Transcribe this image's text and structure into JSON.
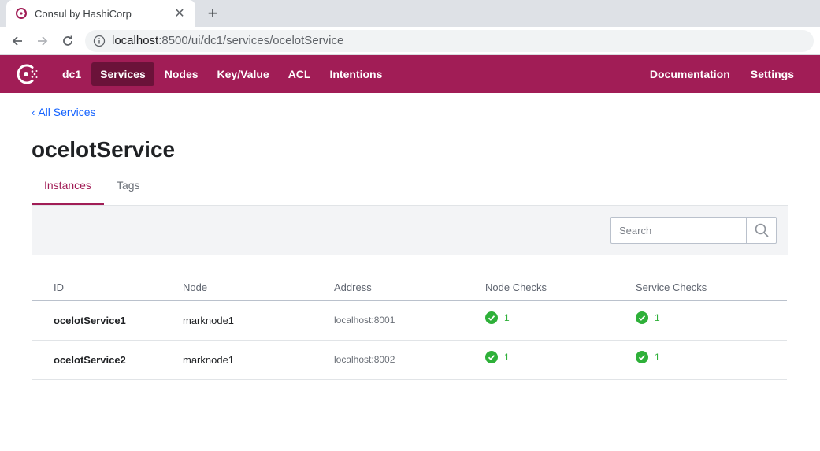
{
  "browser": {
    "tab_title": "Consul by HashiCorp",
    "url_host": "localhost",
    "url_rest": ":8500/ui/dc1/services/ocelotService"
  },
  "nav": {
    "dc": "dc1",
    "items": [
      "Services",
      "Nodes",
      "Key/Value",
      "ACL",
      "Intentions"
    ],
    "active": "Services",
    "right": [
      "Documentation",
      "Settings"
    ]
  },
  "breadcrumb": "All Services",
  "title": "ocelotService",
  "tabs": [
    "Instances",
    "Tags"
  ],
  "search": {
    "placeholder": "Search"
  },
  "table": {
    "headers": [
      "ID",
      "Node",
      "Address",
      "Node Checks",
      "Service Checks"
    ],
    "rows": [
      {
        "id": "ocelotService1",
        "node": "marknode1",
        "address": "localhost:8001",
        "node_checks": "1",
        "service_checks": "1"
      },
      {
        "id": "ocelotService2",
        "node": "marknode1",
        "address": "localhost:8002",
        "node_checks": "1",
        "service_checks": "1"
      }
    ]
  },
  "colors": {
    "brand": "#a11d56",
    "link": "#1563ff",
    "passing": "#2eb039"
  }
}
